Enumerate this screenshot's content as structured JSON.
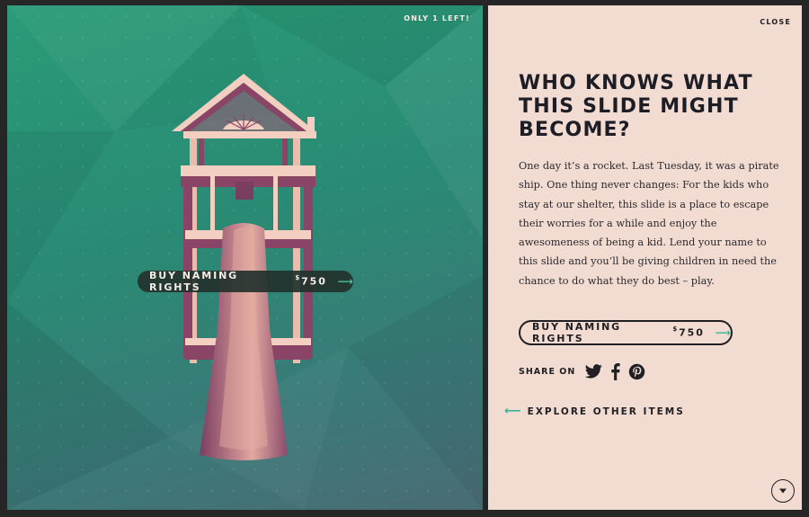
{
  "product": {
    "stock_badge": "ONLY 1 LEFT!",
    "image_label": "Playset with slide",
    "overlay_buy_label": "BUY NAMING RIGHTS",
    "price_symbol": "$",
    "price_value": "750"
  },
  "panel": {
    "close_label": "CLOSE",
    "headline": "WHO KNOWS WHAT THIS SLIDE MIGHT BECOME?",
    "body": "One day it’s a rocket. Last Tuesday, it was a pirate ship. One thing never changes: For the kids who stay at our shelter, this slide is a place to escape their worries for a while and enjoy the awesomeness of being a kid. Lend your name to this slide and you’ll be giving children in need the chance to do what they do best – play.",
    "buy_label": "BUY NAMING RIGHTS",
    "price_symbol": "$",
    "price_value": "750",
    "share_label": "SHARE ON",
    "share_icons": [
      "twitter-icon",
      "facebook-icon",
      "pinterest-icon"
    ],
    "explore_label": "EXPLORE OTHER ITEMS",
    "scroll_icon": "chevron-down-icon"
  },
  "colors": {
    "left_bg": "#2a9b78",
    "right_bg": "#f2dbd1",
    "accent": "#3ab596",
    "text_dark": "#1f1f24",
    "slide": "#9a5478",
    "frame": "#f2cfc0"
  }
}
